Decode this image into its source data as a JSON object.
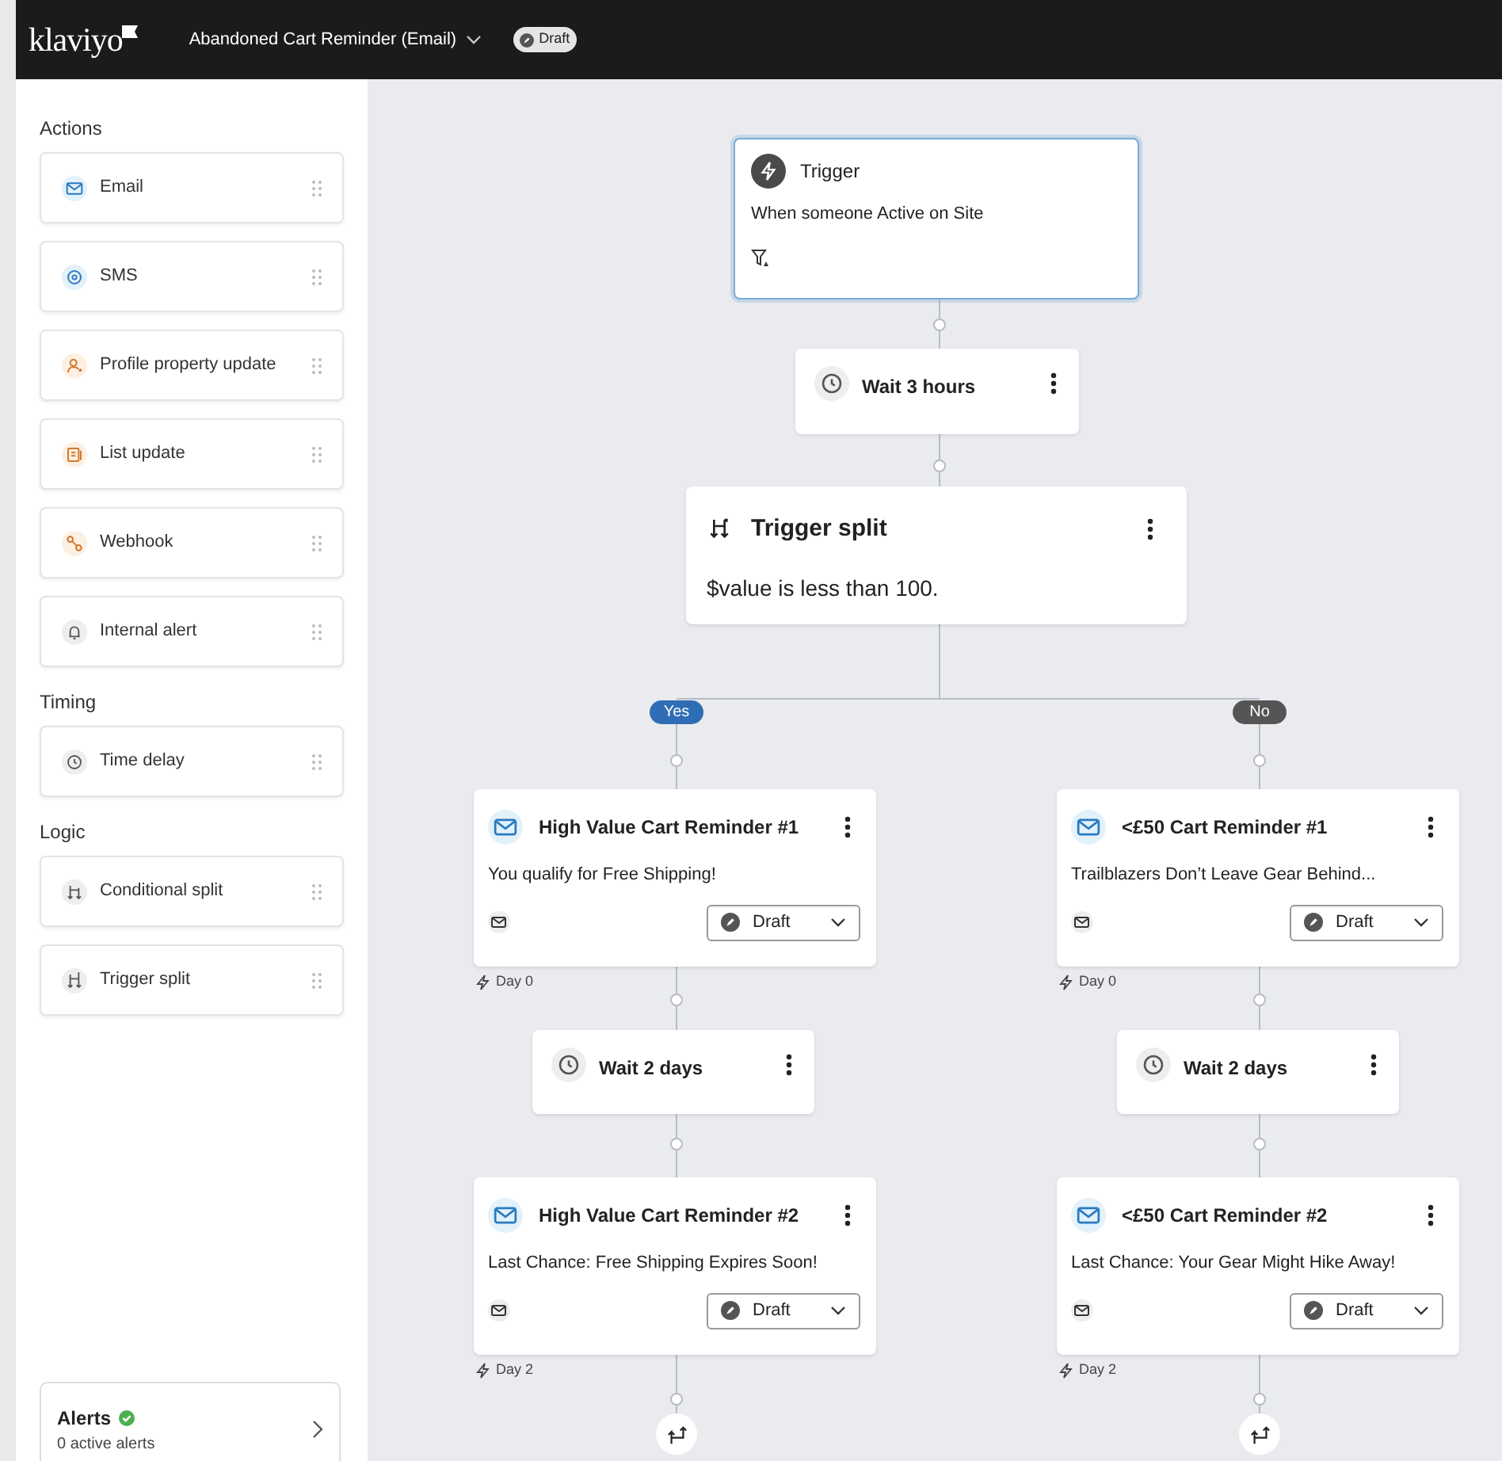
{
  "header": {
    "logo": "klaviyo",
    "flow_title": "Abandoned Cart Reminder (Email)",
    "status": "Draft"
  },
  "sidebar": {
    "sections": [
      {
        "title": "Actions",
        "items": [
          {
            "label": "Email",
            "kind": "email"
          },
          {
            "label": "SMS",
            "kind": "sms"
          },
          {
            "label": "Profile property update",
            "kind": "profile"
          },
          {
            "label": "List update",
            "kind": "list"
          },
          {
            "label": "Webhook",
            "kind": "webhook"
          },
          {
            "label": "Internal alert",
            "kind": "alert"
          }
        ]
      },
      {
        "title": "Timing",
        "items": [
          {
            "label": "Time delay",
            "kind": "delay"
          }
        ]
      },
      {
        "title": "Logic",
        "items": [
          {
            "label": "Conditional split",
            "kind": "conditional"
          },
          {
            "label": "Trigger split",
            "kind": "split"
          }
        ]
      }
    ],
    "alerts": {
      "title": "Alerts",
      "subtitle": "0 active alerts"
    }
  },
  "flow": {
    "trigger": {
      "title": "Trigger",
      "description": "When someone Active on Site"
    },
    "wait": {
      "title": "Wait 3 hours"
    },
    "split": {
      "title": "Trigger split",
      "condition": "$value is less than 100."
    },
    "branches": [
      {
        "label": "Yes",
        "kind": "yes",
        "steps": [
          {
            "kind": "email",
            "title": "High Value Cart Reminder #1",
            "subject": "You qualify for Free Shipping!",
            "status": "Draft",
            "day": "Day 0"
          },
          {
            "kind": "wait",
            "title": "Wait 2 days"
          },
          {
            "kind": "email",
            "title": "High Value Cart Reminder #2",
            "subject": "Last Chance: Free Shipping Expires Soon!",
            "status": "Draft",
            "day": "Day 2"
          }
        ]
      },
      {
        "label": "No",
        "kind": "no",
        "steps": [
          {
            "kind": "email",
            "title": "<£50 Cart Reminder #1",
            "subject": "Trailblazers Don’t Leave Gear Behind...",
            "status": "Draft",
            "day": "Day 0"
          },
          {
            "kind": "wait",
            "title": "Wait 2 days"
          },
          {
            "kind": "email",
            "title": "<£50 Cart Reminder #2",
            "subject": "Last Chance: Your Gear Might Hike Away!",
            "status": "Draft",
            "day": "Day 2"
          }
        ]
      }
    ]
  }
}
